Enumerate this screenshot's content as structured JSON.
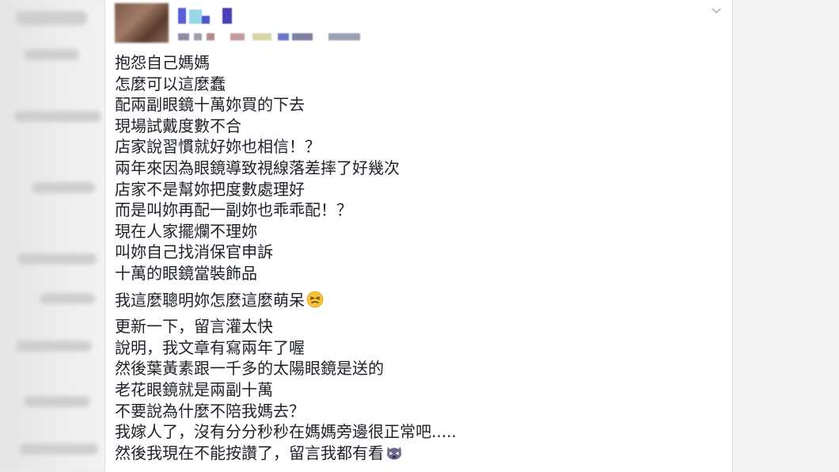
{
  "post": {
    "paragraphs": [
      {
        "lines": [
          "抱怨自己媽媽",
          "怎麼可以這麼蠢",
          "配兩副眼鏡十萬妳買的下去",
          "現場試戴度數不合",
          "店家說習慣就好妳也相信！？",
          "兩年來因為眼鏡導致視線落差摔了好幾次",
          "店家不是幫妳把度數處理好",
          "而是叫妳再配一副妳也乖乖配！？",
          "現在人家擺爛不理妳",
          "叫妳自己找消保官申訴",
          "十萬的眼鏡當裝飾品"
        ]
      },
      {
        "lines": [
          "我這麼聰明妳怎麼這麼萌呆"
        ],
        "emoji": "persevering-face-emoji"
      },
      {
        "lines": [
          "更新一下，留言灌太快",
          "說明，我文章有寫兩年了喔",
          "然後葉黃素跟一千多的太陽眼鏡是送的",
          "老花眼鏡就是兩副十萬",
          "不要說為什麼不陪我媽去？",
          "我嫁人了，沒有分分秒秒在媽媽旁邊很正常吧.....",
          "然後我現在不能按讚了，留言我都有看"
        ],
        "emoji": "weary-cat-emoji"
      }
    ]
  },
  "icons": {
    "menu": "chevron-down-icon",
    "avatar": "avatar-blurred"
  },
  "colors": {
    "text": "#1d2129",
    "card_bg": "#ffffff",
    "page_bg": "#ececec"
  }
}
